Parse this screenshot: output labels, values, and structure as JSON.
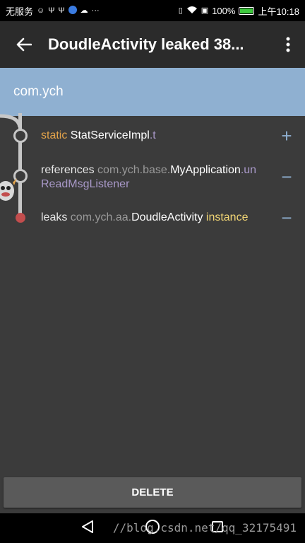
{
  "status_bar": {
    "carrier": "无服务",
    "icons": [
      "smiley-icon",
      "usb-icon",
      "usb-icon",
      "app-badge-icon",
      "cloud-icon",
      "more-icon"
    ],
    "battery_percent": "100%",
    "battery_level": 1.0,
    "time": "上午10:18"
  },
  "app_bar": {
    "title": "DoudleActivity leaked 38..."
  },
  "root": {
    "label": "com.ych"
  },
  "trace": [
    {
      "parts": [
        {
          "text": "static ",
          "style": "orange"
        },
        {
          "text": "StatServiceImpl",
          "style": "white"
        },
        {
          "text": ".t",
          "style": "purple"
        }
      ],
      "toggle": "+"
    },
    {
      "line1": [
        {
          "text": "references ",
          "style": "default"
        },
        {
          "text": "com.ych.base.",
          "style": "gray"
        },
        {
          "text": "MyApplication",
          "style": "white"
        },
        {
          "text": ".un",
          "style": "purple"
        }
      ],
      "line2": [
        {
          "text": "ReadMsgListener",
          "style": "purple"
        }
      ],
      "toggle": "−"
    },
    {
      "parts": [
        {
          "text": "leaks ",
          "style": "default"
        },
        {
          "text": "com.ych.aa.",
          "style": "gray"
        },
        {
          "text": "DoudleActivity",
          "style": "white"
        },
        {
          "text": " instance",
          "style": "yellow"
        }
      ],
      "toggle": "−"
    }
  ],
  "delete_button": {
    "label": "DELETE"
  },
  "watermark": "//blog.csdn.net/qq_32175491",
  "colors": {
    "accent": "#8fb0d1",
    "background": "#3b3b3b",
    "app_bar": "#2b2b2b",
    "leak_dot": "#c24d4d"
  }
}
